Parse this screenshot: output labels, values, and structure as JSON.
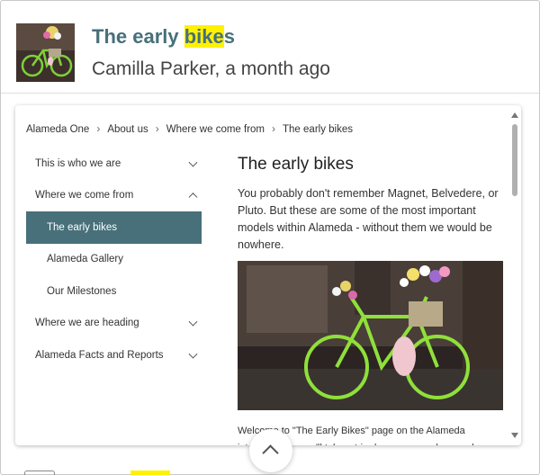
{
  "result": {
    "title_pre": "The early ",
    "title_highlight": "bike",
    "title_post": "s",
    "meta": "Camilla Parker, a month ago"
  },
  "breadcrumb": [
    "Alameda One",
    "About us",
    "Where we come from",
    "The early bikes"
  ],
  "nav": [
    {
      "label": "This is who we are",
      "chevron": "down"
    },
    {
      "label": "Where we come from",
      "chevron": "up"
    },
    {
      "label": "The early bikes",
      "active": true
    },
    {
      "label": "Alameda Gallery"
    },
    {
      "label": "Our Milestones"
    },
    {
      "label": "Where we are heading",
      "chevron": "down"
    },
    {
      "label": "Alameda Facts and Reports",
      "chevron": "down"
    }
  ],
  "content": {
    "heading": "The early bikes",
    "lead": "You probably don't remember Magnet, Belvedere, or Pluto. But these are some of the most important models within Alameda - without them we would be nowhere.",
    "body": "Welcome to \"The Early Bikes\" page on the Alameda intranet! Here, we'll take a trip down memory lane and celebrate some of the bikes that helped establish Alameda as a leading bicycle"
  },
  "colors": {
    "accent": "#47707a",
    "highlight": "#fff200"
  }
}
